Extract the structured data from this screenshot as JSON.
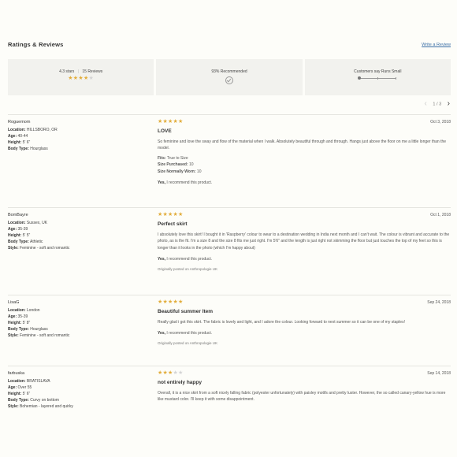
{
  "header": {
    "title": "Ratings & Reviews",
    "write_link": "Write a Review"
  },
  "summary": {
    "rating_text": "4.3 stars",
    "reviews_count": "15 Reviews",
    "recommended": "93% Recommended",
    "runs_small": "Customers say Runs Small",
    "avg_stars": 4.3,
    "fit_fraction": 0.0
  },
  "pagination": {
    "label": "1 / 3"
  },
  "reviews": [
    {
      "username": "Roguemom",
      "details": [
        {
          "label": "Location:",
          "value": "HILLSBORO, OR"
        },
        {
          "label": "Age:",
          "value": "40-44"
        },
        {
          "label": "Height:",
          "value": "5' 6\""
        },
        {
          "label": "Body Type:",
          "value": "Hourglass"
        }
      ],
      "stars": 5,
      "date": "Oct 3, 2018",
      "title": "LOVE",
      "body": "So feminine and love the sway and flow of the material when I walk. Absolutely beautiful through and through. Hangs just above the floor on me a little longer than the model.",
      "attributes": [
        {
          "label": "Fits:",
          "value": "True to Size"
        },
        {
          "label": "Size Purchased:",
          "value": "10"
        },
        {
          "label": "Size Normally Worn:",
          "value": "10"
        }
      ],
      "recommend_yes": "Yes,",
      "recommend_text": "I recommend this product.",
      "origin": ""
    },
    {
      "username": "BomBayre",
      "details": [
        {
          "label": "Location:",
          "value": "Sussex, UK"
        },
        {
          "label": "Age:",
          "value": "35-39"
        },
        {
          "label": "Height:",
          "value": "5' 5\""
        },
        {
          "label": "Body Type:",
          "value": "Athletic"
        },
        {
          "label": "Style:",
          "value": "Feminine - soft and romantic"
        }
      ],
      "stars": 5,
      "date": "Oct 1, 2018",
      "title": "Perfect skirt",
      "body": "I absolutely love this skirt! I bought it in 'Raspberry' colour to wear to a destination wedding in India next month and I can't wait.  The colour is vibrant and accurate to the photo, as is the fit. I'm a size 8 and the size 8 fits me just right. I'm 5'6\" and the length is just right not skimming the floor but just touches the top of my feet so this is longer than it looks in the photo (which I'm happy about)",
      "attributes": [],
      "recommend_yes": "Yes,",
      "recommend_text": "I recommend this product.",
      "origin": "Originally posted on Anthropologie UK"
    },
    {
      "username": "LisaG",
      "details": [
        {
          "label": "Location:",
          "value": "London"
        },
        {
          "label": "Age:",
          "value": "35-39"
        },
        {
          "label": "Height:",
          "value": "5' 8\""
        },
        {
          "label": "Body Type:",
          "value": "Hourglass"
        },
        {
          "label": "Style:",
          "value": "Feminine - soft and romantic"
        }
      ],
      "stars": 5,
      "date": "Sep 24, 2018",
      "title": "Beautiful summer Item",
      "body": "Really glad i got this skirt. The fabric is lovely and light, and I adore the colour. Looking forward to next summer so it can be one of my staples!",
      "attributes": [],
      "recommend_yes": "Yes,",
      "recommend_text": "I recommend this product.",
      "origin": "Originally posted on Anthropologie UK"
    },
    {
      "username": "farbuska",
      "details": [
        {
          "label": "Location:",
          "value": "BRATISLAVA"
        },
        {
          "label": "Age:",
          "value": "Over 55"
        },
        {
          "label": "Height:",
          "value": "5' 6\""
        },
        {
          "label": "Body Type:",
          "value": "Curvy on bottom"
        },
        {
          "label": "Style:",
          "value": "Bohemian - layered and quirky"
        }
      ],
      "stars": 3,
      "date": "Sep 14, 2018",
      "title": "not entirely happy",
      "body": "Overall, it is a nice skirt from a soft nicely falling fabric (polyester unfortunately) with paisley motifs and pretty luster. However, the so called canary-yellow hue is more like mustard color. I'll keep it with some disappointment.",
      "attributes": [],
      "recommend_yes": "",
      "recommend_text": "",
      "origin": ""
    }
  ],
  "colors": {
    "star_on": "#e2ad3b",
    "star_off": "#d4d4d4",
    "link": "#3a6ea5",
    "summary_bg": "#f2f2ee"
  }
}
